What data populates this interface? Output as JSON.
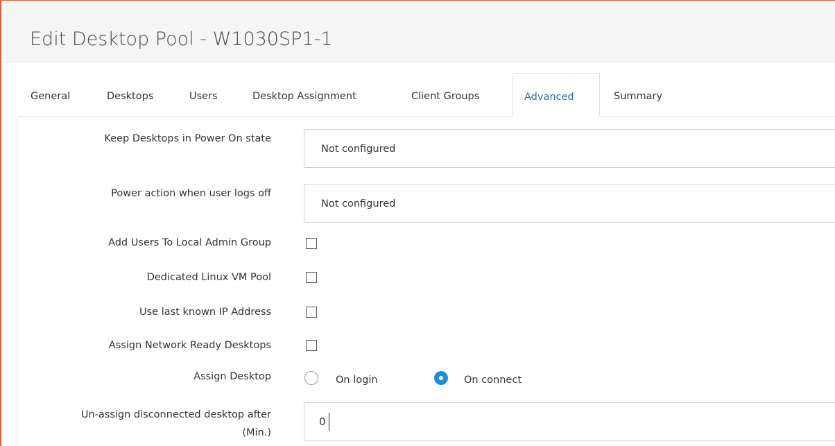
{
  "title": "Edit Desktop Pool - W1030SP1-1",
  "tabs": [
    {
      "label": "General"
    },
    {
      "label": "Desktops"
    },
    {
      "label": "Users"
    },
    {
      "label": "Desktop Assignment"
    },
    {
      "label": "Client Groups"
    },
    {
      "label": "Advanced"
    },
    {
      "label": "Summary"
    }
  ],
  "active_tab": "Advanced",
  "form": {
    "power_on_state": {
      "label": "Keep Desktops in Power On state",
      "value": "Not configured"
    },
    "power_action_logoff": {
      "label": "Power action when user logs off",
      "value": "Not configured"
    },
    "local_admin_group": {
      "label": "Add Users To Local Admin Group",
      "checked": false
    },
    "linux_vm_pool": {
      "label": "Dedicated Linux VM Pool",
      "checked": false
    },
    "last_known_ip": {
      "label": "Use last known IP Address",
      "checked": false
    },
    "network_ready": {
      "label": "Assign Network Ready Desktops",
      "checked": false
    },
    "assign_desktop": {
      "label": "Assign Desktop",
      "options": [
        {
          "label": "On login",
          "selected": false
        },
        {
          "label": "On connect",
          "selected": true
        }
      ]
    },
    "unassign_disconnected": {
      "label_line1": "Un-assign disconnected desktop after",
      "label_line2": "(Min.)",
      "value": "0"
    }
  },
  "colors": {
    "frame_border": "#d9623a",
    "active_tab_text": "#2f6fa7",
    "radio_selected": "#1a8fd6"
  }
}
